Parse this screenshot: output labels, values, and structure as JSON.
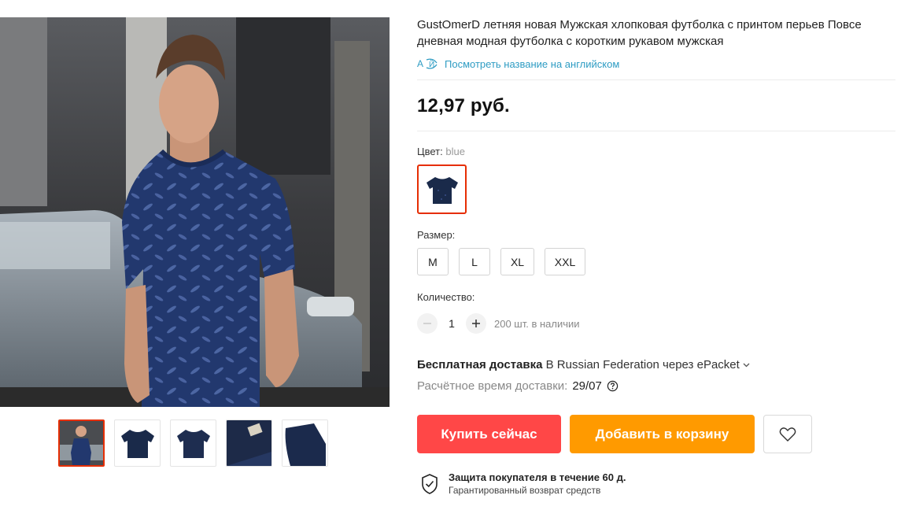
{
  "product": {
    "title_line1": "GustOmerD летняя новая Мужская хлопковая футболка с принтом перьев Повсе",
    "title_line2": "дневная модная футболка с коротким рукавом мужская",
    "translate_link": "Посмотреть название на английском",
    "price": "12,97 руб."
  },
  "color": {
    "label": "Цвет:",
    "value": "blue",
    "swatch_color": "#1a2a4a"
  },
  "size": {
    "label": "Размер:",
    "options": [
      "M",
      "L",
      "XL",
      "XXL"
    ]
  },
  "quantity": {
    "label": "Количество:",
    "value": "1",
    "stock": "200 шт. в наличии"
  },
  "shipping": {
    "free_label": "Бесплатная доставка",
    "destination": " В Russian Federation через ePacket ",
    "delivery_label": "Расчётное время доставки:",
    "delivery_date": "29/07"
  },
  "actions": {
    "buy_now": "Купить сейчас",
    "add_to_cart": "Добавить в корзину"
  },
  "protection": {
    "line1": "Защита покупателя в течение 60 д.",
    "line2": "Гарантированный возврат средств"
  },
  "colors": {
    "buy_button": "#ff4747",
    "cart_button": "#ff9a00",
    "selected_border": "#e62e04",
    "link": "#2e9cc3",
    "shirt_navy": "#22386e"
  },
  "icons": {
    "translate": "translate-icon",
    "help": "help-circle-icon",
    "wishlist": "heart-icon",
    "protection": "shield-check-icon",
    "chevron": "chevron-down-icon"
  }
}
